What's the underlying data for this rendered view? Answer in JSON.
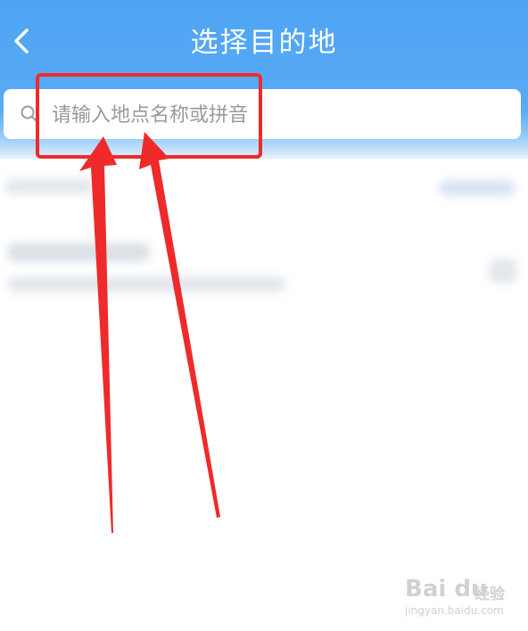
{
  "header": {
    "title": "选择目的地",
    "back_icon": "chevron-left-icon",
    "background_color": "#4ea4f4"
  },
  "search": {
    "placeholder": "请输入地点名称或拼音",
    "value": "",
    "icon": "search-icon"
  },
  "annotation": {
    "color": "#ef2a2a"
  },
  "watermark": {
    "brand": "Bai du",
    "jingyan": "经验",
    "url": "jingyan.baidu.com"
  }
}
